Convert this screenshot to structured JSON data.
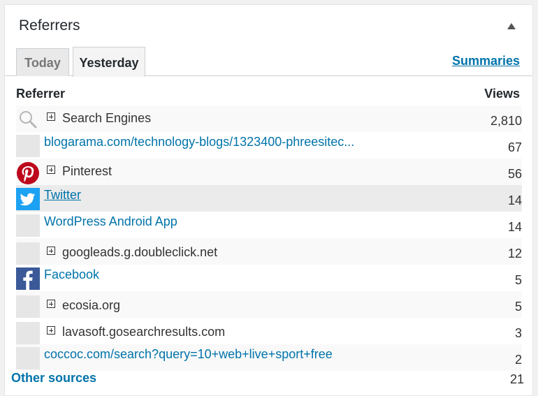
{
  "widget": {
    "title": "Referrers"
  },
  "tabs": [
    {
      "label": "Today",
      "active": false
    },
    {
      "label": "Yesterday",
      "active": true
    }
  ],
  "summaries_link": "Summaries",
  "columns": {
    "referrer": "Referrer",
    "views": "Views"
  },
  "rows": [
    {
      "icon": "search-icon",
      "expandable": true,
      "link": false,
      "label": "Search Engines",
      "views": "2,810"
    },
    {
      "icon": "blank",
      "expandable": false,
      "link": true,
      "label": "blogarama.com/technology-blogs/1323400-phreesitec...",
      "views": "67"
    },
    {
      "icon": "pinterest-icon",
      "expandable": true,
      "link": false,
      "label": "Pinterest",
      "views": "56"
    },
    {
      "icon": "twitter-icon",
      "expandable": false,
      "link": true,
      "label": "Twitter",
      "views": "14"
    },
    {
      "icon": "blank",
      "expandable": false,
      "link": true,
      "label": "WordPress Android App",
      "views": "14"
    },
    {
      "icon": "blank",
      "expandable": true,
      "link": false,
      "label": "googleads.g.doubleclick.net",
      "views": "12"
    },
    {
      "icon": "facebook-icon",
      "expandable": false,
      "link": true,
      "label": "Facebook",
      "views": "5"
    },
    {
      "icon": "blank",
      "expandable": true,
      "link": false,
      "label": "ecosia.org",
      "views": "5"
    },
    {
      "icon": "blank",
      "expandable": true,
      "link": false,
      "label": "lavasoft.gosearchresults.com",
      "views": "3"
    },
    {
      "icon": "blank",
      "expandable": false,
      "link": true,
      "label": "coccoc.com/search?query=10+web+live+sport+free",
      "views": "2"
    }
  ],
  "other_sources": {
    "label": "Other sources",
    "views": "21"
  },
  "colors": {
    "link": "#0073aa",
    "pinterest": "#bd081c",
    "twitter": "#1da1f2",
    "facebook": "#3b5998"
  }
}
